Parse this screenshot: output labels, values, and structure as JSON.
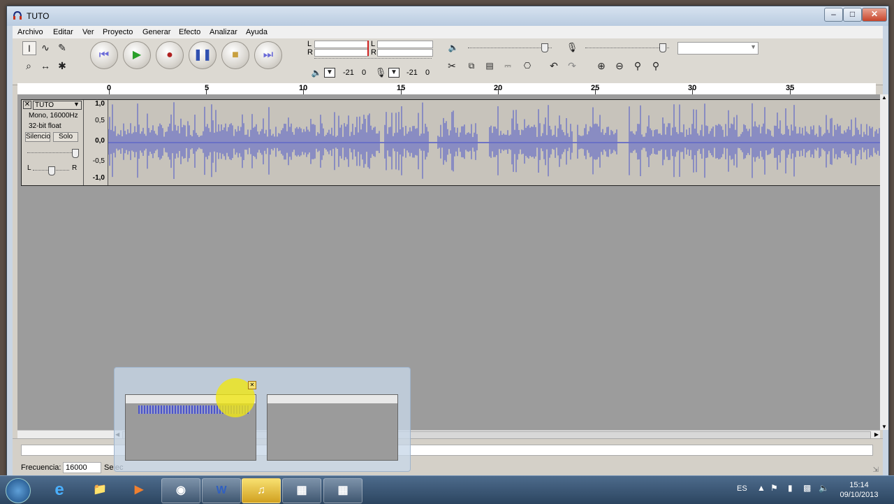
{
  "window": {
    "title": "TUTO"
  },
  "menu": [
    "Archivo",
    "Editar",
    "Ver",
    "Proyecto",
    "Generar",
    "Efecto",
    "Analizar",
    "Ayuda"
  ],
  "meters": {
    "left_label": "L",
    "right_label": "R",
    "db_left": "-21",
    "zero_left": "0",
    "db_right": "-21",
    "zero_right": "0"
  },
  "ruler": {
    "labels": [
      "0",
      "5",
      "10",
      "15",
      "20",
      "25",
      "30",
      "35"
    ]
  },
  "track": {
    "name": "TUTO",
    "info1": "Mono, 16000Hz",
    "info2": "32-bit float",
    "mute": "Silencio",
    "solo": "Solo",
    "pan_l": "L",
    "pan_r": "R",
    "scale": [
      "1,0",
      "0,5",
      "0,0",
      "-0,5",
      "-1,0"
    ]
  },
  "status": {
    "freq_label": "Frecuencia:",
    "freq_value": "16000",
    "sel_label": "Selec"
  },
  "taskbar": {
    "lang": "ES",
    "time": "15:14",
    "date": "09/10/2013"
  },
  "colors": {
    "waveform": "#4b55c9",
    "title_bar": "#c9d5e3",
    "taskbar": "#2c4560"
  }
}
